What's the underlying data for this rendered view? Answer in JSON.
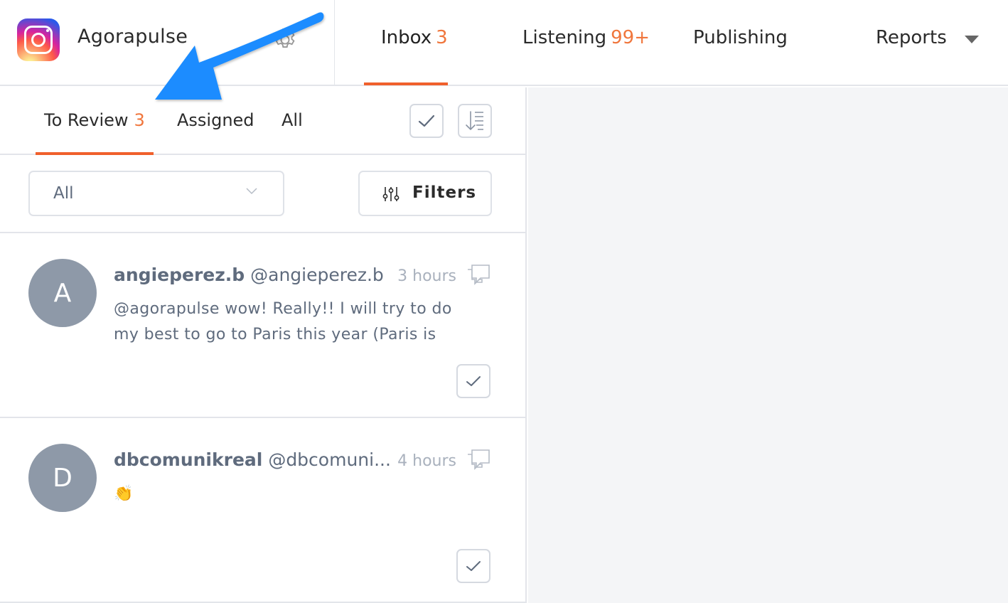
{
  "account": {
    "name": "Agorapulse",
    "network_icon": "instagram-icon",
    "settings_icon": "gear-icon"
  },
  "main_nav": {
    "tabs": [
      {
        "label": "Inbox",
        "count": "3",
        "active": true
      },
      {
        "label": "Listening",
        "count": "99+",
        "active": false
      },
      {
        "label": "Publishing",
        "count": "",
        "active": false
      },
      {
        "label": "Reports",
        "count": "",
        "active": false,
        "has_dropdown": true
      }
    ]
  },
  "inbox": {
    "subtabs": [
      {
        "label": "To Review",
        "count": "3",
        "active": true
      },
      {
        "label": "Assigned",
        "count": "",
        "active": false
      },
      {
        "label": "All",
        "count": "",
        "active": false
      }
    ],
    "actions": {
      "mark_all_reviewed_icon": "check-icon",
      "sort_icon": "sort-descending-icon"
    },
    "filter_select": {
      "value": "All"
    },
    "filters_button": {
      "label": "Filters",
      "icon": "sliders-icon"
    }
  },
  "messages": [
    {
      "avatar_letter": "A",
      "name": "angieperez.b",
      "handle": "@angieperez.b",
      "time": "3 hours",
      "body": "@agorapulse wow! Really!! I will try to do my best to go to Paris this year (Paris is",
      "type_icon": "conversation-icon"
    },
    {
      "avatar_letter": "D",
      "name": "dbcomunikreal",
      "handle": "@dbcomuni...",
      "time": "4 hours",
      "body": "👏",
      "type_icon": "conversation-icon"
    }
  ],
  "colors": {
    "accent": "#f0602c",
    "count": "#f0763c",
    "annotation_arrow": "#1a8cff",
    "avatar_bg": "#8e99a8"
  }
}
